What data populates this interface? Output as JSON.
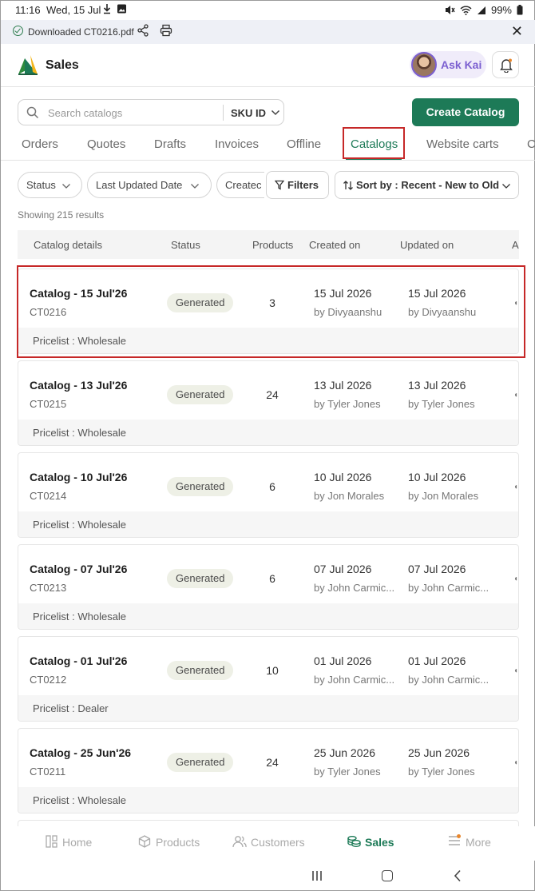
{
  "status_bar": {
    "time": "11:16",
    "date": "Wed, 15 Jul",
    "battery": "99%"
  },
  "download_banner": {
    "message": "Downloaded CT0216.pdf"
  },
  "header": {
    "title": "Sales",
    "ask_kai_label": "Ask Kai"
  },
  "search": {
    "placeholder": "Search catalogs",
    "field_selector": "SKU ID"
  },
  "create_button": "Create Catalog",
  "tabs": [
    {
      "label": "Orders"
    },
    {
      "label": "Quotes"
    },
    {
      "label": "Drafts"
    },
    {
      "label": "Invoices"
    },
    {
      "label": "Offline"
    },
    {
      "label": "Catalogs",
      "active": true
    },
    {
      "label": "Website carts"
    },
    {
      "label": "C"
    }
  ],
  "filters": {
    "status": "Status",
    "last_updated": "Last Updated Date",
    "created": "Createc",
    "filters_button": "Filters",
    "sort": "Sort by : Recent - New to Old"
  },
  "results_text": "Showing 215 results",
  "table": {
    "headers": [
      "Catalog details",
      "Status",
      "Products",
      "Created on",
      "Updated on",
      "A"
    ],
    "rows": [
      {
        "name": "Catalog - 15 Jul'26",
        "code": "CT0216",
        "status": "Generated",
        "products": "3",
        "created_date": "15 Jul 2026",
        "created_by": "by Divyaanshu",
        "updated_date": "15 Jul 2026",
        "updated_by": "by Divyaanshu",
        "pricelist": "Pricelist : Wholesale"
      },
      {
        "name": "Catalog - 13 Jul'26",
        "code": "CT0215",
        "status": "Generated",
        "products": "24",
        "created_date": "13 Jul 2026",
        "created_by": "by Tyler Jones",
        "updated_date": "13 Jul 2026",
        "updated_by": "by Tyler Jones",
        "pricelist": "Pricelist : Wholesale"
      },
      {
        "name": "Catalog - 10 Jul'26",
        "code": "CT0214",
        "status": "Generated",
        "products": "6",
        "created_date": "10 Jul 2026",
        "created_by": "by Jon Morales",
        "updated_date": "10 Jul 2026",
        "updated_by": "by Jon Morales",
        "pricelist": "Pricelist : Wholesale"
      },
      {
        "name": "Catalog - 07 Jul'26",
        "code": "CT0213",
        "status": "Generated",
        "products": "6",
        "created_date": "07 Jul 2026",
        "created_by": "by John Carmic...",
        "updated_date": "07 Jul 2026",
        "updated_by": "by John Carmic...",
        "pricelist": "Pricelist : Wholesale"
      },
      {
        "name": "Catalog - 01 Jul'26",
        "code": "CT0212",
        "status": "Generated",
        "products": "10",
        "created_date": "01 Jul 2026",
        "created_by": "by John Carmic...",
        "updated_date": "01 Jul 2026",
        "updated_by": "by John Carmic...",
        "pricelist": "Pricelist : Dealer"
      },
      {
        "name": "Catalog - 25 Jun'26",
        "code": "CT0211",
        "status": "Generated",
        "products": "24",
        "created_date": "25 Jun 2026",
        "created_by": "by Tyler Jones",
        "updated_date": "25 Jun 2026",
        "updated_by": "by Tyler Jones",
        "pricelist": "Pricelist : Wholesale"
      }
    ]
  },
  "bottom_nav": [
    {
      "label": "Home",
      "icon": "home-icon"
    },
    {
      "label": "Products",
      "icon": "box-icon"
    },
    {
      "label": "Customers",
      "icon": "users-icon"
    },
    {
      "label": "Sales",
      "icon": "coins-icon",
      "active": true
    },
    {
      "label": "More",
      "icon": "menu-icon"
    }
  ],
  "colors": {
    "brand": "#1d7a57",
    "highlight": "#c62828",
    "ask_kai": "#7b5fd0"
  }
}
